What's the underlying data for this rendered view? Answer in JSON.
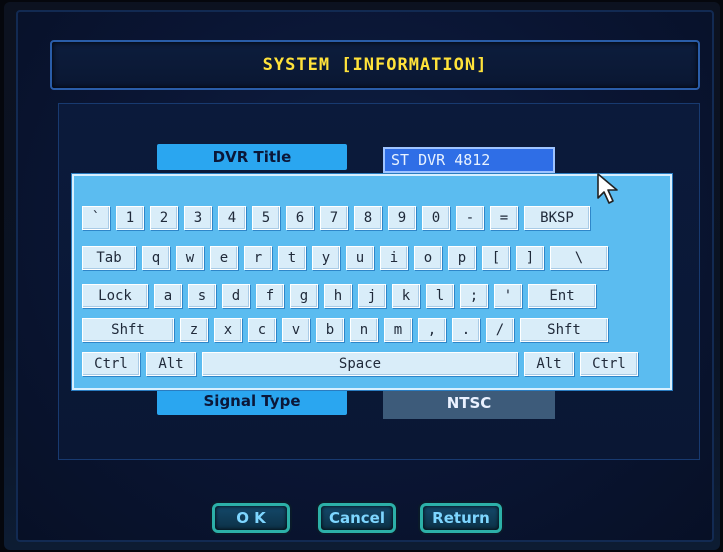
{
  "window": {
    "title": "SYSTEM [INFORMATION]"
  },
  "fields": {
    "dvr_title_label": "DVR Title",
    "dvr_title_value": "ST DVR 4812",
    "signal_type_label": "Signal Type",
    "signal_type_value": "NTSC"
  },
  "keyboard": {
    "row1": [
      "`",
      "1",
      "2",
      "3",
      "4",
      "5",
      "6",
      "7",
      "8",
      "9",
      "0",
      "-",
      "=",
      "BKSP"
    ],
    "row2": [
      "Tab",
      "q",
      "w",
      "e",
      "r",
      "t",
      "y",
      "u",
      "i",
      "o",
      "p",
      "[",
      "]",
      "\\"
    ],
    "row3": [
      "Lock",
      "a",
      "s",
      "d",
      "f",
      "g",
      "h",
      "j",
      "k",
      "l",
      ";",
      "'",
      "Ent"
    ],
    "row4": [
      "Shft",
      "z",
      "x",
      "c",
      "v",
      "b",
      "n",
      "m",
      ",",
      ".",
      "/",
      "Shft"
    ],
    "row5": [
      "Ctrl",
      "Alt",
      "Space",
      "Alt",
      "Ctrl"
    ]
  },
  "buttons": {
    "ok": "O K",
    "cancel": "Cancel",
    "return": "Return"
  },
  "colors": {
    "title_text": "#ffe23a",
    "label_bg": "#2aa6f0",
    "value_bg": "#2f6ee6",
    "keyboard_bg": "#5bbcf0",
    "button_border": "#2cb0a8"
  },
  "icons": {
    "cursor": "mouse-pointer-icon"
  }
}
